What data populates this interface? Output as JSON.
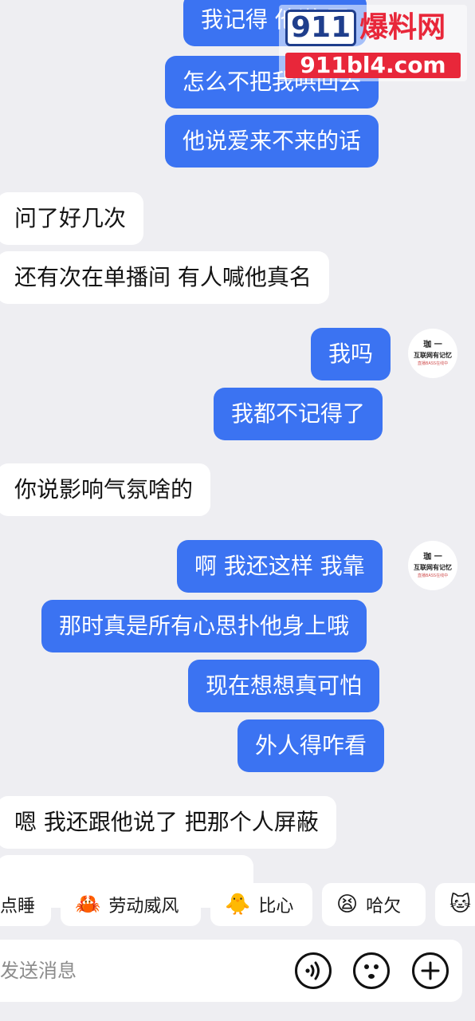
{
  "watermark": {
    "logo_number": "911",
    "logo_text": "爆料网",
    "url": "911bl4.com"
  },
  "avatar": {
    "line1": "珈 一",
    "line2": "互联网有记忆",
    "line3": "直播BASS在线中"
  },
  "messages": [
    {
      "side": "out",
      "text": "我记得 他说 回"
    },
    {
      "side": "out",
      "text": "怎么不把我哄回去"
    },
    {
      "side": "out",
      "text": "他说爱来不来的话"
    },
    {
      "side": "in",
      "text": "问了好几次"
    },
    {
      "side": "in",
      "text": "还有次在单播间 有人喊他真名"
    },
    {
      "side": "out",
      "text": "我吗"
    },
    {
      "side": "out",
      "text": "我都不记得了"
    },
    {
      "side": "in",
      "text": "你说影响气氛啥的"
    },
    {
      "side": "out",
      "text": "啊 我还这样 我靠"
    },
    {
      "side": "out",
      "text": "那时真是所有心思扑他身上哦"
    },
    {
      "side": "out",
      "text": "现在想想真可怕"
    },
    {
      "side": "out",
      "text": "外人得咋看"
    },
    {
      "side": "in",
      "text": "嗯 我还跟他说了 把那个人屏蔽"
    },
    {
      "side": "in",
      "text": ""
    }
  ],
  "quick_replies": [
    {
      "emoji": "",
      "label": "点睡"
    },
    {
      "emoji": "🦀",
      "label": "劳动威风"
    },
    {
      "emoji": "🐥",
      "label": "比心"
    },
    {
      "emoji": "😫",
      "label": "哈欠"
    },
    {
      "emoji": "🐱",
      "label": ""
    }
  ],
  "input": {
    "placeholder": "发送消息",
    "voice_icon": "voice-icon",
    "emoji_icon": "emoji-icon",
    "plus_icon": "plus-icon"
  },
  "colors": {
    "outgoing_bubble": "#3b73f2",
    "incoming_bubble": "#ffffff",
    "background": "#eeeef2"
  }
}
